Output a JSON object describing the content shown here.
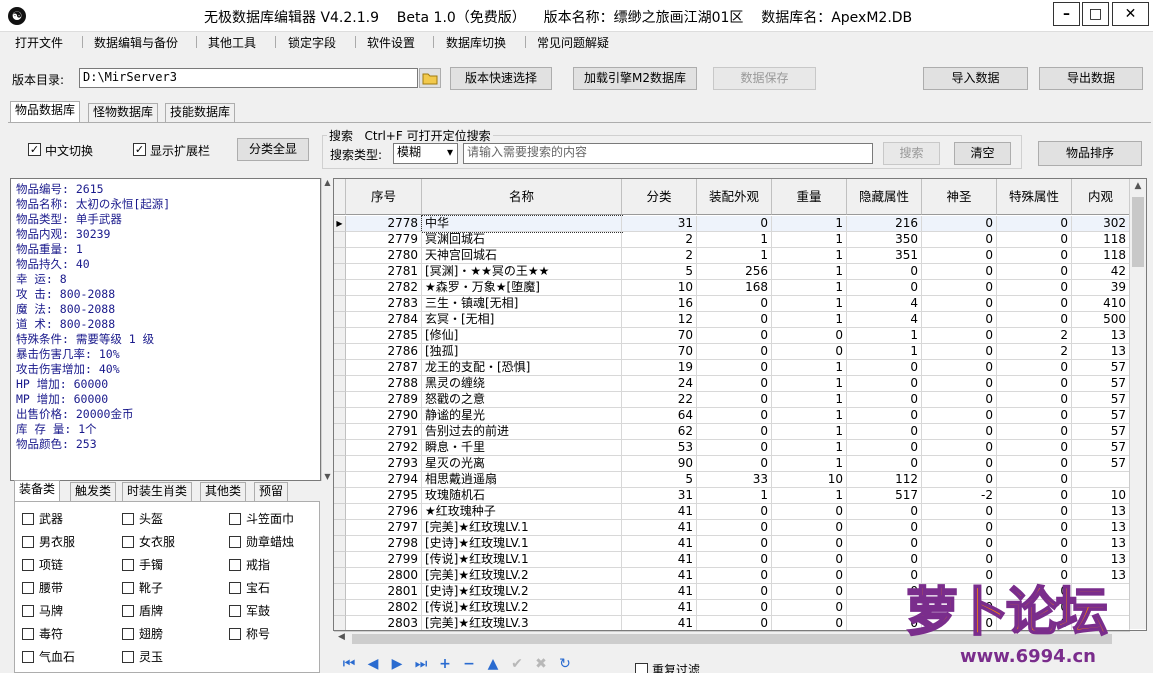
{
  "window": {
    "title": "无极数据库编辑器 V4.2.1.9    Beta 1.0（免费版）    版本名称：缥缈之旅画江湖01区    数据库名：ApexM2.DB",
    "icon_glyph": "☯",
    "min_label": "–",
    "max_label": "□",
    "close_label": "✕"
  },
  "menu": [
    "打开文件",
    "数据编辑与备份",
    "其他工具",
    "锁定字段",
    "软件设置",
    "数据库切换",
    "常见问题解疑"
  ],
  "toolbar": {
    "dir_label": "版本目录:",
    "dir_value": "D:\\MirServer3",
    "quick_select": "版本快速选择",
    "load_engine": "加载引擎M2数据库",
    "save_data": "数据保存",
    "import_data": "导入数据",
    "export_data": "导出数据"
  },
  "tabs": [
    "物品数据库",
    "怪物数据库",
    "技能数据库"
  ],
  "options": {
    "chinese_toggle": "中文切换",
    "show_ext": "显示扩展栏",
    "show_all": "分类全显"
  },
  "search": {
    "title": "搜索   Ctrl+F 可打开定位搜索",
    "type_label": "搜索类型:",
    "type_value": "模糊",
    "placeholder": "请输入需要搜索的内容",
    "search_btn": "搜索",
    "clear_btn": "清空",
    "sort_btn": "物品排序"
  },
  "info_lines": [
    "物品编号: 2615",
    "物品名称: 太初の永恒[起源]",
    "物品类型: 单手武器",
    "物品内观: 30239",
    "物品重量: 1",
    "物品持久: 40",
    "幸    运: 8",
    "攻    击: 800-2088",
    "魔    法: 800-2088",
    "道    术: 800-2088",
    "特殊条件: 需要等级 1 级",
    "暴击伤害几率: 10%",
    "攻击伤害增加: 40%",
    "HP  增加: 60000",
    "MP  增加: 60000",
    "出售价格: 20000金币",
    "库 存 量: 1个",
    "物品颜色: 253"
  ],
  "cat_tabs": [
    "装备类",
    "触发类",
    "时装生肖类",
    "其他类",
    "预留"
  ],
  "cat_items": [
    [
      "武器",
      "头盔",
      "斗笠面巾"
    ],
    [
      "男衣服",
      "女衣服",
      "勋章蜡烛"
    ],
    [
      "项链",
      "手镯",
      "戒指"
    ],
    [
      "腰带",
      "靴子",
      "宝石"
    ],
    [
      "马牌",
      "盾牌",
      "军鼓"
    ],
    [
      "毒符",
      "翅膀",
      "称号"
    ],
    [
      "气血石",
      "灵玉",
      ""
    ]
  ],
  "grid": {
    "columns": [
      "序号",
      "名称",
      "分类",
      "装配外观",
      "重量",
      "隐藏属性",
      "神圣",
      "特殊属性",
      "内观"
    ],
    "rows": [
      [
        "2778",
        "中华",
        "31",
        "0",
        "1",
        "216",
        "0",
        "0",
        "302"
      ],
      [
        "2779",
        "冥渊回城石",
        "2",
        "1",
        "1",
        "350",
        "0",
        "0",
        "118"
      ],
      [
        "2780",
        "天神宫回城石",
        "2",
        "1",
        "1",
        "351",
        "0",
        "0",
        "118"
      ],
      [
        "2781",
        "[冥渊]・★★冥の王★★",
        "5",
        "256",
        "1",
        "0",
        "0",
        "0",
        "42"
      ],
      [
        "2782",
        "★森罗・万象★[堕魔]",
        "10",
        "168",
        "1",
        "0",
        "0",
        "0",
        "39"
      ],
      [
        "2783",
        "三生・镇魂[无相]",
        "16",
        "0",
        "1",
        "4",
        "0",
        "0",
        "410"
      ],
      [
        "2784",
        "玄冥・[无相]",
        "12",
        "0",
        "1",
        "4",
        "0",
        "0",
        "500"
      ],
      [
        "2785",
        "[修仙]",
        "70",
        "0",
        "0",
        "1",
        "0",
        "2",
        "13"
      ],
      [
        "2786",
        "[独孤]",
        "70",
        "0",
        "0",
        "1",
        "0",
        "2",
        "13"
      ],
      [
        "2787",
        "龙王的支配・[恐惧]",
        "19",
        "0",
        "1",
        "0",
        "0",
        "0",
        "57"
      ],
      [
        "2788",
        "黑灵の缠绕",
        "24",
        "0",
        "1",
        "0",
        "0",
        "0",
        "57"
      ],
      [
        "2789",
        "怒戳の之意",
        "22",
        "0",
        "1",
        "0",
        "0",
        "0",
        "57"
      ],
      [
        "2790",
        "静谧的星光",
        "64",
        "0",
        "1",
        "0",
        "0",
        "0",
        "57"
      ],
      [
        "2791",
        "告别过去的前进",
        "62",
        "0",
        "1",
        "0",
        "0",
        "0",
        "57"
      ],
      [
        "2792",
        "瞬息・千里",
        "53",
        "0",
        "1",
        "0",
        "0",
        "0",
        "57"
      ],
      [
        "2793",
        "星灭の光离",
        "90",
        "0",
        "1",
        "0",
        "0",
        "0",
        "57"
      ],
      [
        "2794",
        "相思戴逍遥扇",
        "5",
        "33",
        "10",
        "112",
        "0",
        "0",
        ""
      ],
      [
        "2795",
        "玫瑰随机石",
        "31",
        "1",
        "1",
        "517",
        "-2",
        "0",
        "10"
      ],
      [
        "2796",
        "★红玫瑰种子",
        "41",
        "0",
        "0",
        "0",
        "0",
        "0",
        "13"
      ],
      [
        "2797",
        "[完美]★红玫瑰LV.1",
        "41",
        "0",
        "0",
        "0",
        "0",
        "0",
        "13"
      ],
      [
        "2798",
        "[史诗]★红玫瑰LV.1",
        "41",
        "0",
        "0",
        "0",
        "0",
        "0",
        "13"
      ],
      [
        "2799",
        "[传说]★红玫瑰LV.1",
        "41",
        "0",
        "0",
        "0",
        "0",
        "0",
        "13"
      ],
      [
        "2800",
        "[完美]★红玫瑰LV.2",
        "41",
        "0",
        "0",
        "0",
        "0",
        "0",
        "13"
      ],
      [
        "2801",
        "[史诗]★红玫瑰LV.2",
        "41",
        "0",
        "0",
        "0",
        "0",
        "0",
        ""
      ],
      [
        "2802",
        "[传说]★红玫瑰LV.2",
        "41",
        "0",
        "0",
        "0",
        "0",
        "0",
        ""
      ],
      [
        "2803",
        "[完美]★红玫瑰LV.3",
        "41",
        "0",
        "0",
        "0",
        "0",
        "0",
        ""
      ]
    ]
  },
  "filter_label": "重复过滤",
  "watermark": {
    "text": "萝卜论坛",
    "url": "www.6994.cn"
  },
  "colors": {
    "info_text": "#1a1a8c",
    "nav_blue": "#2a6bd0",
    "watermark_orange": "#ff8a00",
    "watermark_purple": "#7a2d8c"
  }
}
